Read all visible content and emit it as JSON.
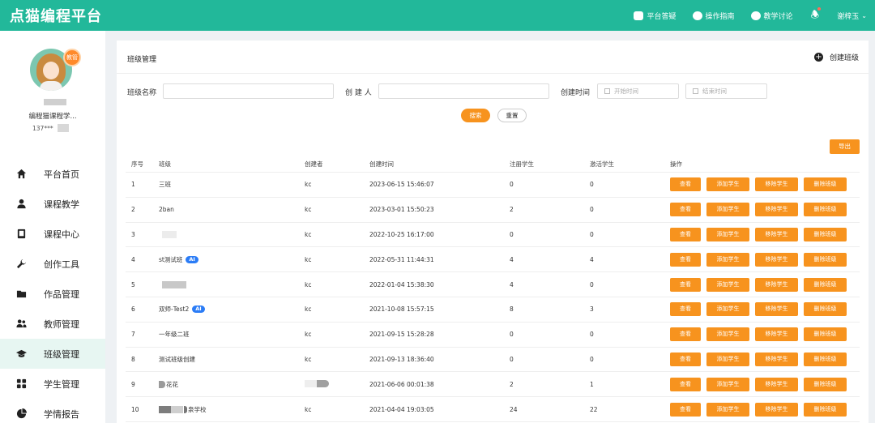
{
  "app": {
    "logo": "点猫编程平台"
  },
  "topnav": {
    "help": "平台答疑",
    "guide": "操作指南",
    "discuss": "教学讨论",
    "user": "谢梓玉"
  },
  "profile": {
    "role_badge": "教管",
    "school": "编程猫课程学...",
    "phone": "137***"
  },
  "menu": [
    {
      "label": "平台首页",
      "icon": "home-icon"
    },
    {
      "label": "课程教学",
      "icon": "user-icon"
    },
    {
      "label": "课程中心",
      "icon": "book-icon"
    },
    {
      "label": "创作工具",
      "icon": "wrench-icon"
    },
    {
      "label": "作品管理",
      "icon": "folder-icon"
    },
    {
      "label": "教师管理",
      "icon": "teachers-icon"
    },
    {
      "label": "班级管理",
      "icon": "graduation-cap-icon",
      "active": true
    },
    {
      "label": "学生管理",
      "icon": "grid-icon"
    },
    {
      "label": "学情报告",
      "icon": "pie-chart-icon"
    }
  ],
  "page": {
    "title": "班级管理",
    "create_label": "创建班级",
    "filters": {
      "class_name_label": "班级名称",
      "creator_label": "创 建 人",
      "created_time_label": "创建时间",
      "start_placeholder": "开始时间",
      "end_placeholder": "结束时间"
    },
    "search_label": "搜索",
    "reset_label": "重置",
    "export_label": "导出"
  },
  "table": {
    "headers": [
      "序号",
      "班级",
      "创建者",
      "创建时间",
      "注册学生",
      "激活学生",
      "操作"
    ],
    "actions": {
      "view": "查看",
      "add": "添加学生",
      "remove": "移除学生",
      "delete": "删除班级"
    },
    "ai_tag": "AI",
    "rows": [
      {
        "no": "1",
        "name": "三班",
        "creator": "kc",
        "time": "2023-06-15 15:46:07",
        "registered": "0",
        "activated": "0"
      },
      {
        "no": "2",
        "name": "2ban",
        "creator": "kc",
        "time": "2023-03-01 15:50:23",
        "registered": "2",
        "activated": "0"
      },
      {
        "no": "3",
        "name": "",
        "creator": "kc",
        "time": "2022-10-25 16:17:00",
        "registered": "0",
        "activated": "0"
      },
      {
        "no": "4",
        "name": "st测试班",
        "ai": true,
        "creator": "kc",
        "time": "2022-05-31 11:44:31",
        "registered": "4",
        "activated": "4"
      },
      {
        "no": "5",
        "name": "",
        "creator": "kc",
        "time": "2022-01-04 15:38:30",
        "registered": "4",
        "activated": "0"
      },
      {
        "no": "6",
        "name": "双师-Test2",
        "ai": true,
        "creator": "kc",
        "time": "2021-10-08 15:57:15",
        "registered": "8",
        "activated": "3"
      },
      {
        "no": "7",
        "name": "一年级二班",
        "creator": "kc",
        "time": "2021-09-15 15:28:28",
        "registered": "0",
        "activated": "0"
      },
      {
        "no": "8",
        "name": "测试班级创建",
        "creator": "kc",
        "time": "2021-09-13 18:36:40",
        "registered": "0",
        "activated": "0"
      },
      {
        "no": "9",
        "name": "花花",
        "creator": "",
        "time": "2021-06-06 00:01:38",
        "registered": "2",
        "activated": "1"
      },
      {
        "no": "10",
        "name": "泉学校",
        "creator": "kc",
        "time": "2021-04-04 19:03:05",
        "registered": "24",
        "activated": "22"
      }
    ]
  }
}
